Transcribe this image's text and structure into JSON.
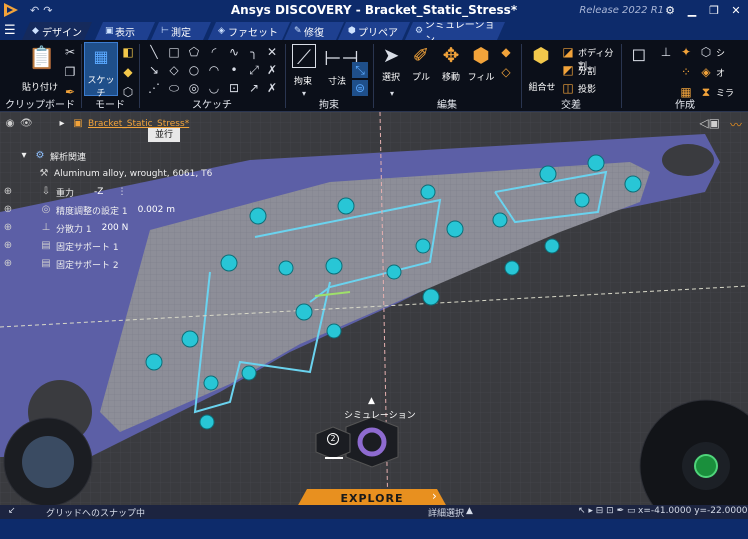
{
  "titlebar": {
    "title": "Ansys DISCOVERY - Bracket_Static_Stress*",
    "release": "Release 2022 R1",
    "undo": "↶",
    "redo": "↷",
    "window_buttons": [
      "▁",
      "❐",
      "✕"
    ]
  },
  "tabs": [
    {
      "label": "デザイン",
      "icon": "design-icon"
    },
    {
      "label": "表示",
      "icon": "display-icon"
    },
    {
      "label": "測定",
      "icon": "measure-icon"
    },
    {
      "label": "ファセット",
      "icon": "facet-icon"
    },
    {
      "label": "修復",
      "icon": "repair-icon"
    },
    {
      "label": "プリペア",
      "icon": "prepare-icon"
    },
    {
      "label": "シミュレーション",
      "icon": "simulation-icon"
    }
  ],
  "ribbon": {
    "clipboard": {
      "label": "クリップボード",
      "paste": "貼り付け"
    },
    "mode": {
      "label": "モード",
      "sketch": "スケッチ"
    },
    "sketch": {
      "label": "スケッチ"
    },
    "constraint": {
      "label": "拘束",
      "constraint_btn": "拘束",
      "dimension_btn": "寸法"
    },
    "edit": {
      "label": "編集",
      "select": "選択",
      "pull": "プル",
      "move": "移動",
      "fill": "フィル"
    },
    "intersect": {
      "label": "交差",
      "combine": "組合せ",
      "split_body": "ボディ分割",
      "split": "分割",
      "project": "投影"
    },
    "create": {
      "label": "作成",
      "items": [
        "シ",
        "オ",
        "ミラ"
      ]
    }
  },
  "tree": {
    "part_name": "Bracket_Static_Stress*",
    "tooltip": "並行",
    "items": [
      {
        "label": "解析関連",
        "value": ""
      },
      {
        "label": "Aluminum alloy, wrought, 6061, T6",
        "value": ""
      },
      {
        "label": "重力",
        "value": "-Z"
      },
      {
        "label": "精度調整の設定 1",
        "value": "0.002 m"
      },
      {
        "label": "分散力 1",
        "value": "200 N"
      },
      {
        "label": "固定サポート 1",
        "value": ""
      },
      {
        "label": "固定サポート 2",
        "value": ""
      }
    ]
  },
  "viewport": {
    "sim_label": "シミュレーション",
    "explore": "EXPLORE",
    "badge_count": "2"
  },
  "status": {
    "snap": "グリッドへのスナップ中",
    "detail_select": "詳細選択",
    "coords": "x=-41.0000  y=-22.0000"
  },
  "colors": {
    "title_bg": "#0d2b6b",
    "ribbon_bg": "#0b0f19",
    "accent_orange": "#e8901f",
    "cyan": "#3fd6e2",
    "plate": "#5c5fa6"
  }
}
